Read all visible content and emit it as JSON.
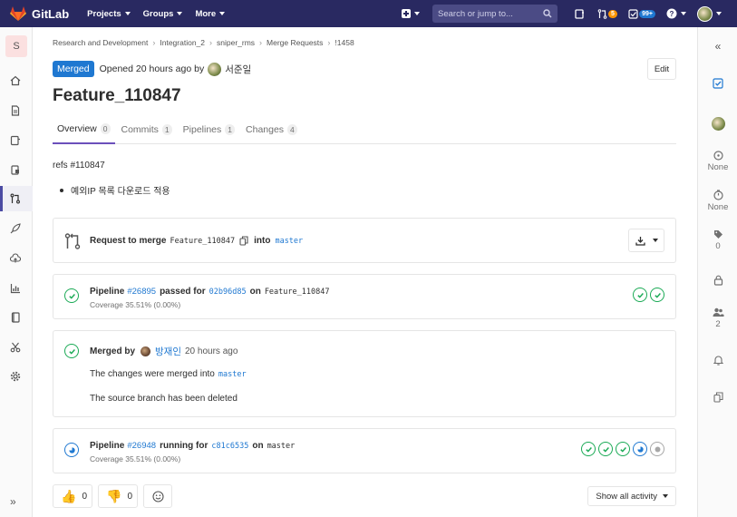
{
  "topnav": {
    "brand": "GitLab",
    "menu": [
      "Projects",
      "Groups",
      "More"
    ],
    "search_placeholder": "Search or jump to...",
    "mr_count": "5",
    "todo_count": "99+"
  },
  "leftbar": {
    "project_letter": "S"
  },
  "breadcrumb": [
    "Research and Development",
    "Integration_2",
    "sniper_rms",
    "Merge Requests",
    "!1458"
  ],
  "header": {
    "status": "Merged",
    "opened_text": "Opened 20 hours ago by",
    "author": "서준일",
    "edit_label": "Edit",
    "title": "Feature_110847"
  },
  "tabs": [
    {
      "label": "Overview",
      "count": "0"
    },
    {
      "label": "Commits",
      "count": "1"
    },
    {
      "label": "Pipelines",
      "count": "1"
    },
    {
      "label": "Changes",
      "count": "4"
    }
  ],
  "description": {
    "refs": "refs #110847",
    "bullet": "예외IP 목록 다운로드 적용"
  },
  "merge_request": {
    "prefix": "Request to merge",
    "source_branch": "Feature_110847",
    "into": "into",
    "target_branch": "master"
  },
  "pipeline1": {
    "label": "Pipeline",
    "id": "#26895",
    "status": "passed for",
    "commit": "02b96d85",
    "on": "on",
    "branch": "Feature_110847",
    "coverage": "Coverage 35.51% (0.00%)"
  },
  "merged": {
    "label": "Merged by",
    "user": "방재인",
    "time": "20 hours ago",
    "line1": "The changes were merged into",
    "target": "master",
    "line2": "The source branch has been deleted"
  },
  "pipeline2": {
    "label": "Pipeline",
    "id": "#26948",
    "status": "running for",
    "commit": "c81c6535",
    "on": "on",
    "branch": "master",
    "coverage": "Coverage 35.51% (0.00%)"
  },
  "reactions": {
    "thumbs_up": "0",
    "thumbs_down": "0",
    "activity_filter": "Show all activity"
  },
  "rightbar": {
    "milestone": "None",
    "time_tracking": "None",
    "labels_count": "0",
    "participants_count": "2"
  },
  "colors": {
    "nav": "#292961",
    "merged": "#1f78d1",
    "success": "#1aaa55",
    "running": "#1f78d1"
  }
}
